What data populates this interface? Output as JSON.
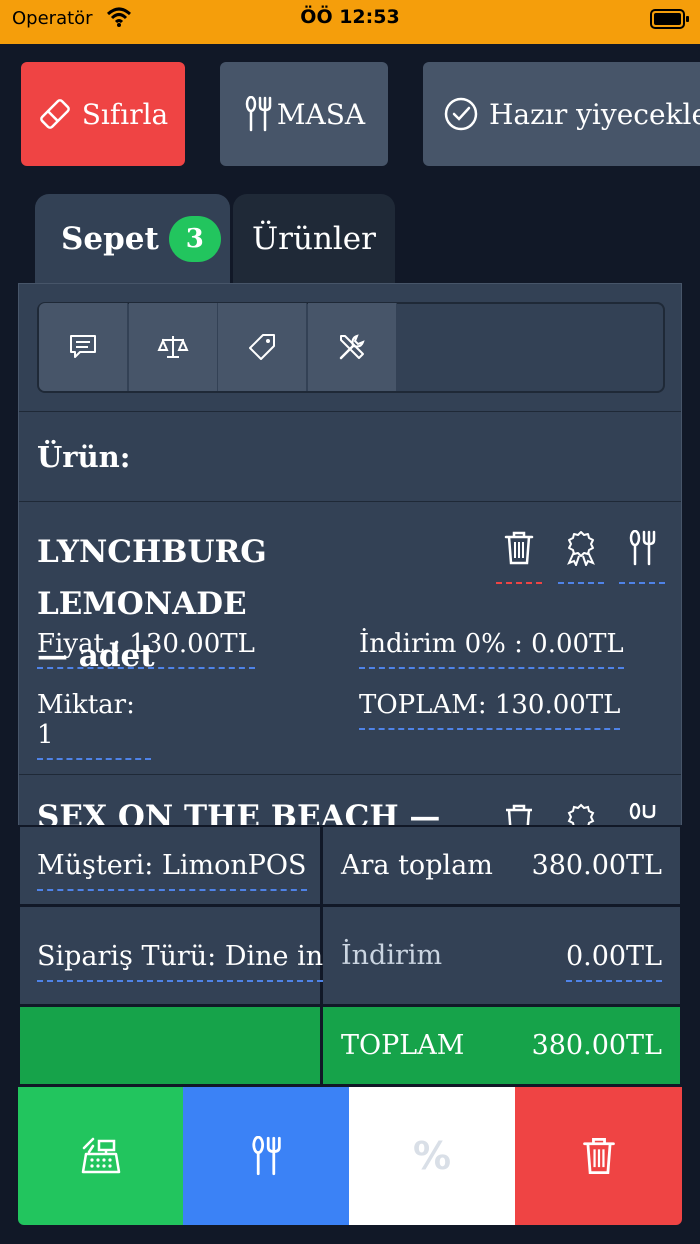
{
  "status_bar": {
    "carrier": "Operatör",
    "time": "ÖÖ 12:53"
  },
  "toolbar": {
    "reset_label": "Sıfırla",
    "table_label": "MASA",
    "ready_label": "Hazır yiyecekler"
  },
  "tabs": {
    "cart_label": "Sepet",
    "cart_count": "3",
    "products_label": "Ürünler"
  },
  "cart": {
    "header": "Ürün:",
    "items": [
      {
        "name": "LYNCHBURG LEMONADE",
        "unit": "— adet",
        "price": "Fiyat : 130.00TL",
        "discount": "İndirim 0% : 0.00TL",
        "quantity": "Miktar: 1",
        "total": "TOPLAM: 130.00TL"
      },
      {
        "name": "SEX ON THE BEACH —"
      }
    ]
  },
  "summary": {
    "customer": "Müşteri: LimonPOS",
    "subtotal_label": "Ara toplam",
    "subtotal_value": "380.00TL",
    "order_type": "Sipariş Türü: Dine in",
    "discount_label": "İndirim",
    "discount_value": "0.00TL",
    "total_label": "TOPLAM",
    "total_value": "380.00TL"
  },
  "actions": {
    "percent_symbol": "%"
  },
  "colors": {
    "status_bar": "#f59e0b",
    "background": "#111827",
    "panel": "#334155",
    "reset": "#ef4444",
    "badge": "#22c55e",
    "total_bar": "#16a34a",
    "pay": "#22c55e",
    "table": "#3b82f6",
    "delete": "#ef4444",
    "dashed_link": "#4f83e8"
  },
  "icons": [
    "wifi-icon",
    "battery-icon",
    "eraser-icon",
    "utensils-icon",
    "check-circle-icon",
    "note-icon",
    "scale-icon",
    "tag-icon",
    "tools-icon",
    "trash-icon",
    "award-icon",
    "cash-register-icon",
    "percent-icon"
  ]
}
